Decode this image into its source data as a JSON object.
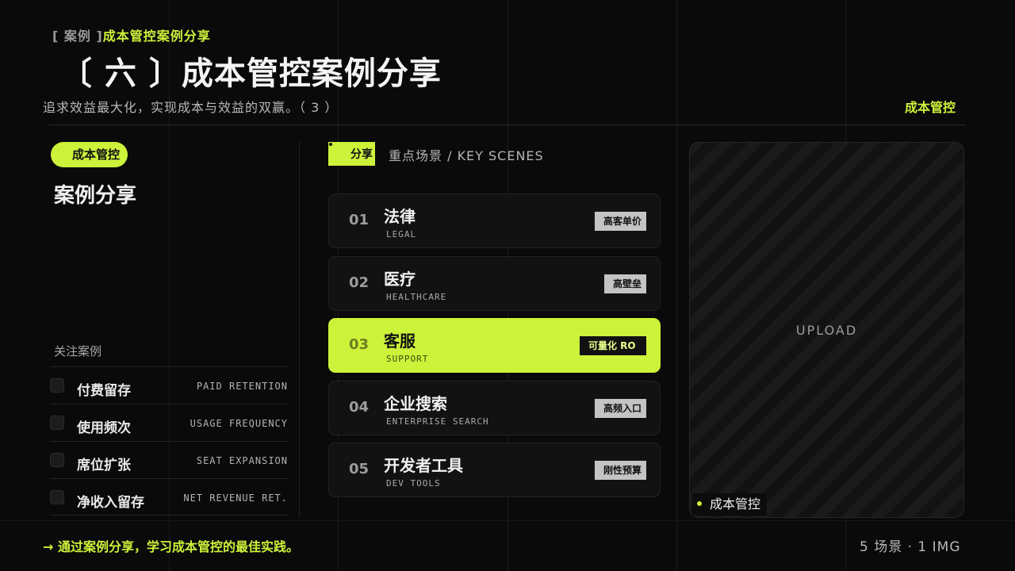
{
  "header": {
    "kicker_bracket": "[ 案例 ]",
    "kicker_text": "成本管控案例分享",
    "title": "〔 六 〕成本管控案例分享",
    "subtitle": "追求效益最大化，实现成本与效益的双赢。（ 3 ）",
    "top_right_tag": "成本管控"
  },
  "left": {
    "pill": "成本管控",
    "title": "案例分享",
    "focus_label": "关注案例",
    "focus_items": [
      {
        "zh": "付费留存",
        "en": "PAID RETENTION"
      },
      {
        "zh": "使用频次",
        "en": "USAGE FREQUENCY"
      },
      {
        "zh": "席位扩张",
        "en": "SEAT EXPANSION"
      },
      {
        "zh": "净收入留存",
        "en": "NET REVENUE RET."
      }
    ]
  },
  "middle": {
    "tag": "分享",
    "heading": "重点场景 / KEY SCENES",
    "scenes": [
      {
        "num": "01",
        "zh": "法律",
        "en": "LEGAL",
        "badge": "高客单价",
        "active": false
      },
      {
        "num": "02",
        "zh": "医疗",
        "en": "HEALTHCARE",
        "badge": "高壁垒",
        "active": false
      },
      {
        "num": "03",
        "zh": "客服",
        "en": "SUPPORT",
        "badge": "可量化 RO",
        "active": true
      },
      {
        "num": "04",
        "zh": "企业搜索",
        "en": "ENTERPRISE SEARCH",
        "badge": "高频入口",
        "active": false
      },
      {
        "num": "05",
        "zh": "开发者工具",
        "en": "DEV TOOLS",
        "badge": "刚性预算",
        "active": false
      }
    ]
  },
  "right": {
    "upload_label": "UPLOAD",
    "caption": "成本管控"
  },
  "footer": {
    "takeaway": "→ 通过案例分享，学习成本管控的最佳实践。",
    "count": "5 场景 · 1 IMG"
  },
  "colors": {
    "accent": "#cdf23a",
    "background": "#0a0a0a",
    "card": "#121212",
    "badge": "#c4c4c4"
  }
}
